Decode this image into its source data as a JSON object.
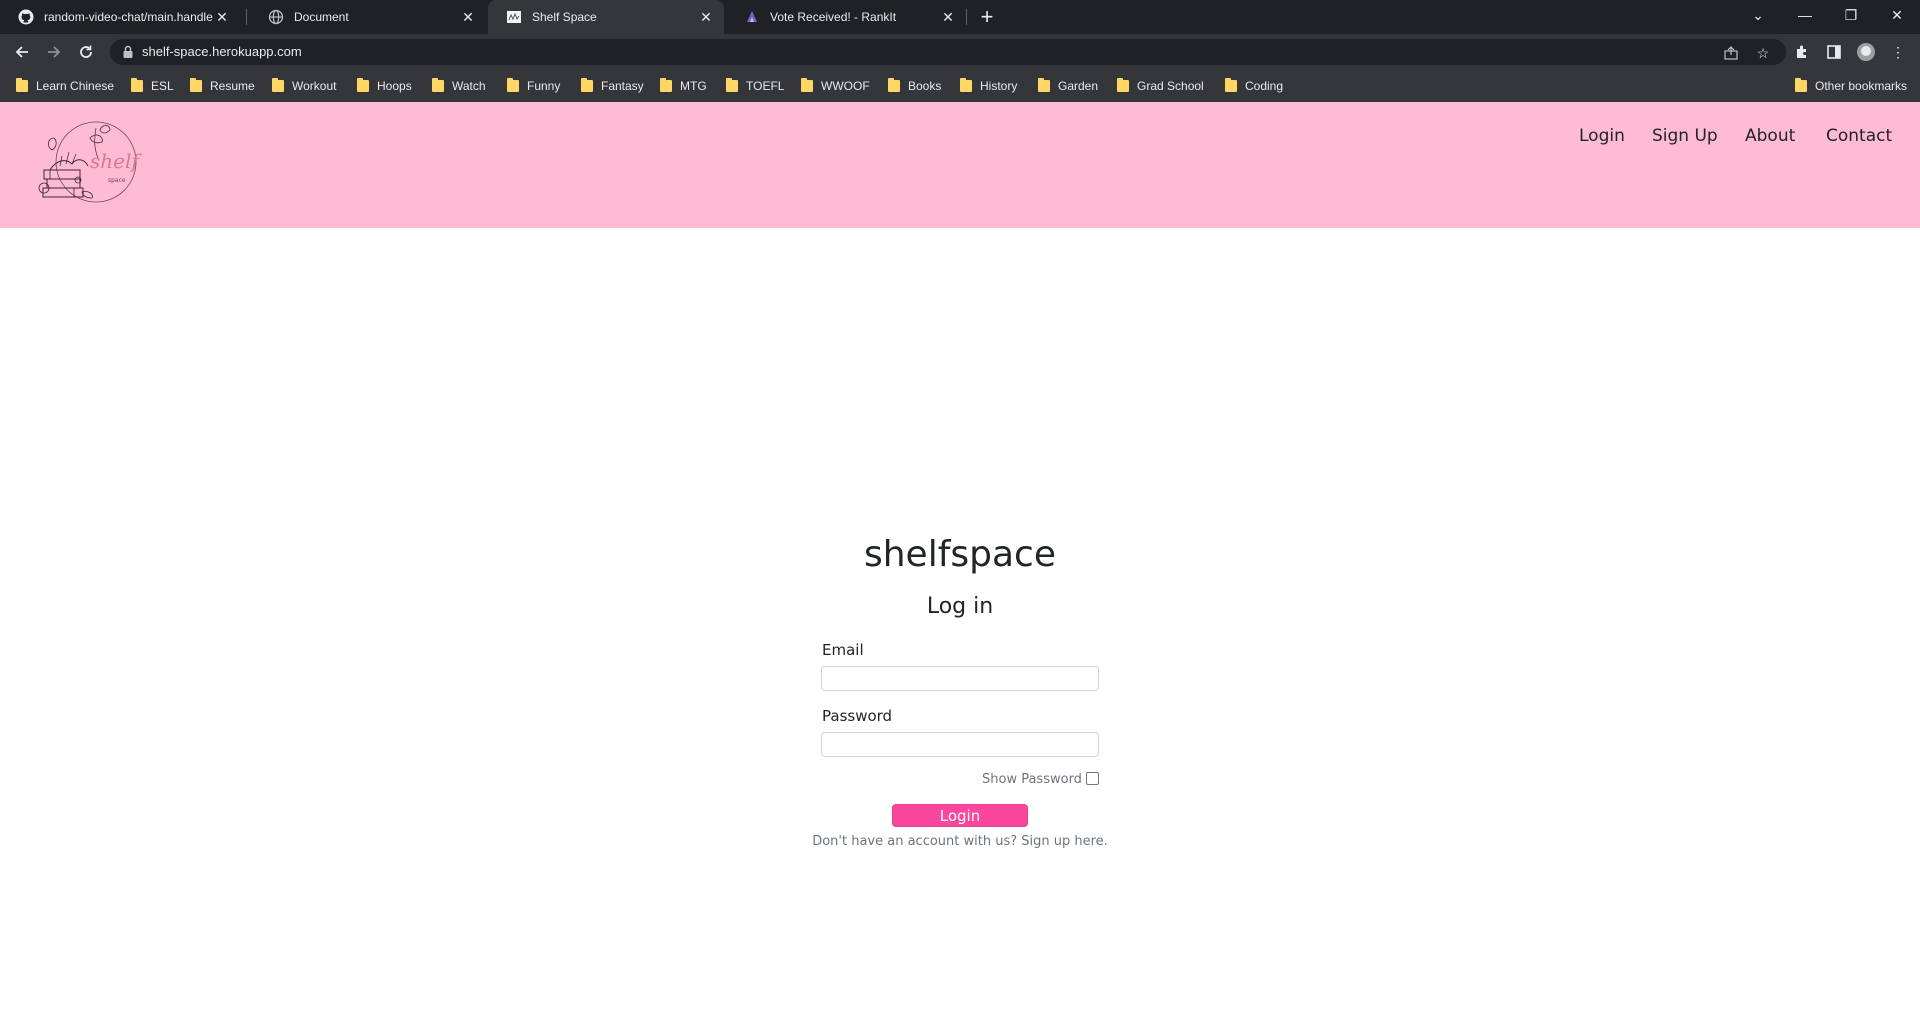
{
  "browser": {
    "tabs": [
      {
        "title": "random-video-chat/main.handle",
        "icon": "github-icon",
        "active": false
      },
      {
        "title": "Document",
        "icon": "globe-icon",
        "active": false
      },
      {
        "title": "Shelf Space",
        "icon": "shelf-space-favicon",
        "active": true
      },
      {
        "title": "Vote Received! - RankIt",
        "icon": "rankit-icon",
        "active": false
      }
    ],
    "url": "shelf-space.herokuapp.com",
    "bookmarks": [
      "Learn Chinese",
      "ESL",
      "Resume",
      "Workout",
      "Hoops",
      "Watch",
      "Funny",
      "Fantasy",
      "MTG",
      "TOEFL",
      "WWOOF",
      "Books",
      "History",
      "Garden",
      "Grad School",
      "Coding"
    ],
    "other_bookmarks": "Other bookmarks"
  },
  "header": {
    "logo_text": "shelf",
    "logo_subtext": "space",
    "nav": [
      "Login",
      "Sign Up",
      "About",
      "Contact"
    ],
    "background": "#ffbbd3"
  },
  "login": {
    "site_name": "shelfspace",
    "title": "Log in",
    "email_label": "Email",
    "email_value": "",
    "password_label": "Password",
    "password_value": "",
    "show_password_label": "Show Password",
    "show_password_checked": false,
    "button_label": "Login",
    "signup_prompt": "Don't have an account with us? Sign up here.",
    "button_color": "#f8479c"
  }
}
